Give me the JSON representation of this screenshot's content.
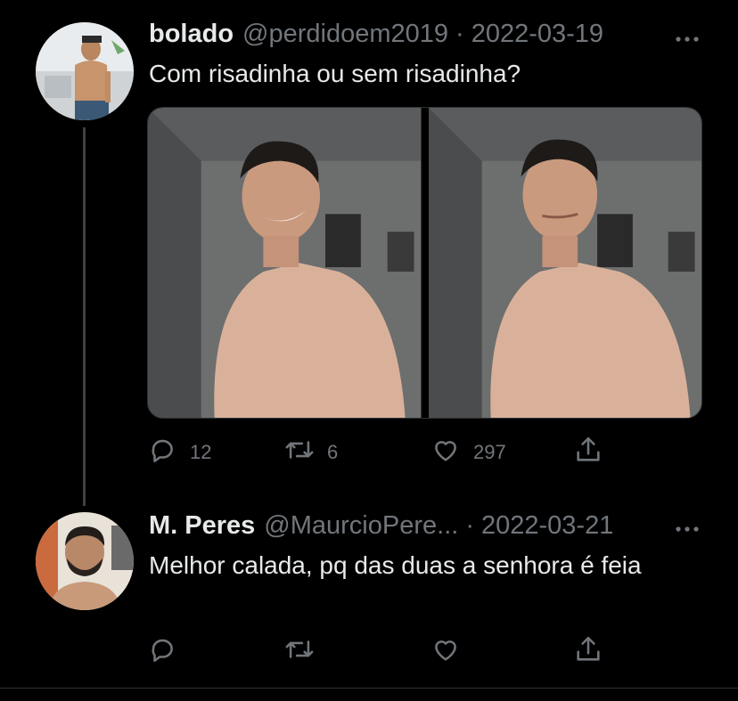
{
  "tweets": [
    {
      "display_name": "bolado",
      "handle": "@perdidoem2019",
      "separator": "·",
      "date": "2022-03-19",
      "text": "Com risadinha ou sem risadinha?",
      "avatar": "avatar-photo",
      "media": [
        "photo-smiling",
        "photo-not-smiling"
      ],
      "actions": {
        "reply_count": "12",
        "retweet_count": "6",
        "like_count": "297"
      }
    },
    {
      "display_name": "M. Peres",
      "handle": "@MaurcioPere...",
      "separator": "·",
      "date": "2022-03-21",
      "text": "Melhor calada, pq das duas a senhora é feia",
      "avatar": "avatar-photo",
      "actions": {
        "reply_count": "",
        "retweet_count": "",
        "like_count": ""
      }
    }
  ],
  "icons": [
    "reply-icon",
    "retweet-icon",
    "like-icon",
    "share-icon",
    "more-icon"
  ],
  "colors": {
    "background": "#000000",
    "text_primary": "#e7e9ea",
    "text_secondary": "#71767b",
    "divider": "#2f3336"
  }
}
